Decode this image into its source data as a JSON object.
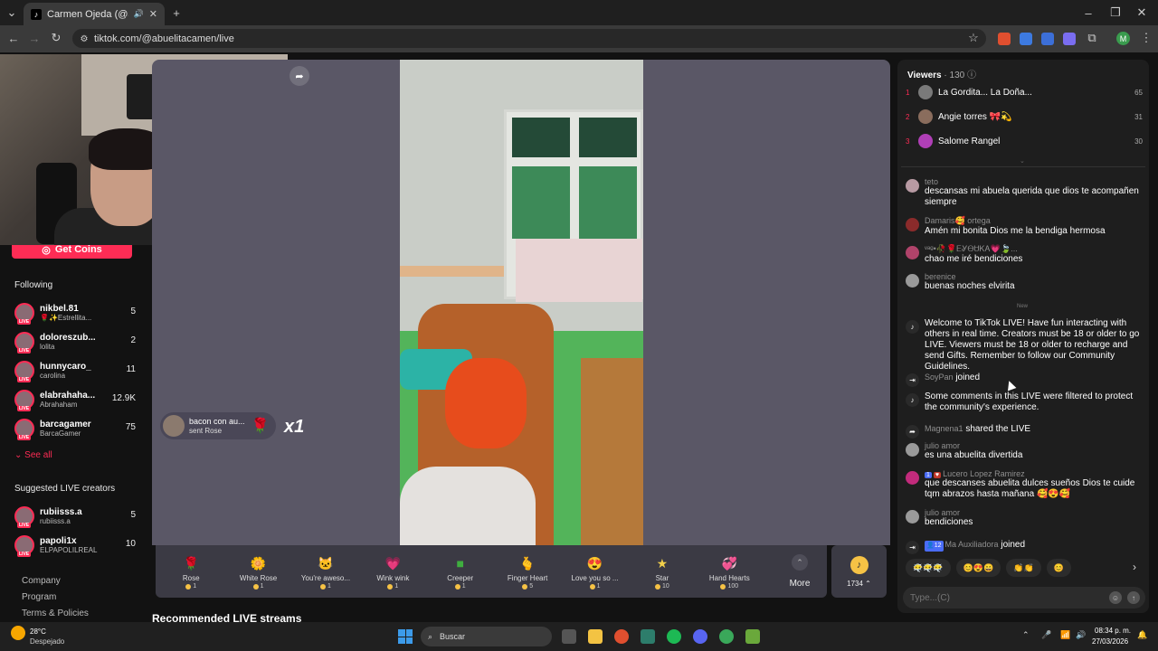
{
  "browser": {
    "tab_title": "Carmen Ojeda (@abuelita…",
    "url": "tiktok.com/@abuelitacamen/live",
    "profile_initial": "M"
  },
  "sidebar": {
    "get_coins_label": "Get Coins",
    "following_title": "Following",
    "following": [
      {
        "name": "nikbel.81",
        "sub": "🌹✨Estrellita...",
        "count": "5"
      },
      {
        "name": "doloreszub...",
        "sub": "lolita",
        "count": "2"
      },
      {
        "name": "hunnycaro_",
        "sub": "carolina",
        "count": "11"
      },
      {
        "name": "elabrahaha...",
        "sub": "Abrahaham",
        "count": "12.9K"
      },
      {
        "name": "barcagamer",
        "sub": "BarcaGamer",
        "count": "75"
      }
    ],
    "see_all_label": "See all",
    "suggested_title": "Suggested LIVE creators",
    "suggested": [
      {
        "name": "rubiisss.a",
        "sub": "rubiisss.a",
        "count": "5"
      },
      {
        "name": "papoli1x",
        "sub": "ELPAPOLILREAL",
        "count": "10"
      }
    ],
    "footer_links": [
      "Company",
      "Program",
      "Terms & Policies"
    ]
  },
  "stream": {
    "gift_notice": {
      "user": "bacon con au...",
      "action": "sent Rose",
      "multiplier": "x1"
    },
    "gifts": [
      {
        "name": "Rose",
        "price": "1",
        "icon": "rose-icon",
        "color": "#e0334e"
      },
      {
        "name": "White Rose",
        "price": "1",
        "icon": "white-rose-icon",
        "color": "#f2efe0"
      },
      {
        "name": "You're aweso...",
        "price": "1",
        "icon": "cat-icon",
        "color": "#d9a977"
      },
      {
        "name": "Wink wink",
        "price": "1",
        "icon": "heart-face-icon",
        "color": "#f071b4"
      },
      {
        "name": "Creeper",
        "price": "1",
        "icon": "creeper-icon",
        "color": "#3fae3f"
      },
      {
        "name": "Finger Heart",
        "price": "5",
        "icon": "finger-heart-icon",
        "color": "#f59a83"
      },
      {
        "name": "Love you so ...",
        "price": "1",
        "icon": "love-icon",
        "color": "#e83a4f"
      },
      {
        "name": "Star",
        "price": "10",
        "icon": "star-icon",
        "color": "#f2d04b"
      },
      {
        "name": "Hand Hearts",
        "price": "100",
        "icon": "hand-hearts-icon",
        "color": "#f08fc2"
      }
    ],
    "more_label": "More",
    "coin_balance": "1734",
    "recommended_title": "Recommended LIVE streams"
  },
  "chat": {
    "viewers_label": "Viewers",
    "viewers_count": "· 130",
    "top_viewers": [
      {
        "rank": "1",
        "name": "La Gordita... La Doña...",
        "score": "65"
      },
      {
        "rank": "2",
        "name": "Angie torres 🎀💫",
        "score": "31"
      },
      {
        "rank": "3",
        "name": "Salome Rangel",
        "score": "30"
      }
    ],
    "messages_top": [
      {
        "user": "teto",
        "text": "descansas mi abuela querida que dios te acompañen siempre"
      },
      {
        "user": "Damaris🥰 ortega",
        "text": "Amén mi bonita Dios me la bendiga hermosa"
      },
      {
        "user": "ᵛᵃᵍ•🥀🌹ᎬᎽᎾᏌᏦᎪ💗🍃...",
        "text": "chao me iré bendiciones"
      },
      {
        "user": "berenice",
        "text": "buenas noches elvirita"
      }
    ],
    "new_label": "New",
    "system_welcome": "Welcome to TikTok LIVE! Have fun interacting with others in real time. Creators must be 18 or older to go LIVE. Viewers must be 18 or older to recharge and send Gifts. Remember to follow our Community Guidelines.",
    "join1_user": "SoyPan",
    "join1_action": "joined",
    "system_filtered": "Some comments in this LIVE were filtered to protect the community's experience.",
    "share_user": "Magnena1",
    "share_action": "shared the LIVE",
    "messages_bottom": [
      {
        "user": "julio amor",
        "text": "es una abuelita divertida"
      },
      {
        "user": "Lucero Lopez Ramirez",
        "badge": "1",
        "text": "que descanses abuelita dulces sueños Dios te cuide tqm abrazos hasta mañana 🥰😍🥰"
      },
      {
        "user": "julio amor",
        "text": "bendiciones"
      }
    ],
    "join2_badge": "12",
    "join2_user": "Ma Auxiliadora",
    "join2_action": "joined",
    "quick_reactions": [
      "😶‍🌫️😶‍🌫️😶‍🌫️",
      "😊😍😄",
      "👏👏",
      "😊"
    ],
    "input_placeholder": "Type...(C)"
  },
  "taskbar": {
    "temp": "28°C",
    "weather": "Despejado",
    "search_placeholder": "Buscar",
    "time": "08:34 p. m.",
    "date": "27/03/2026"
  }
}
